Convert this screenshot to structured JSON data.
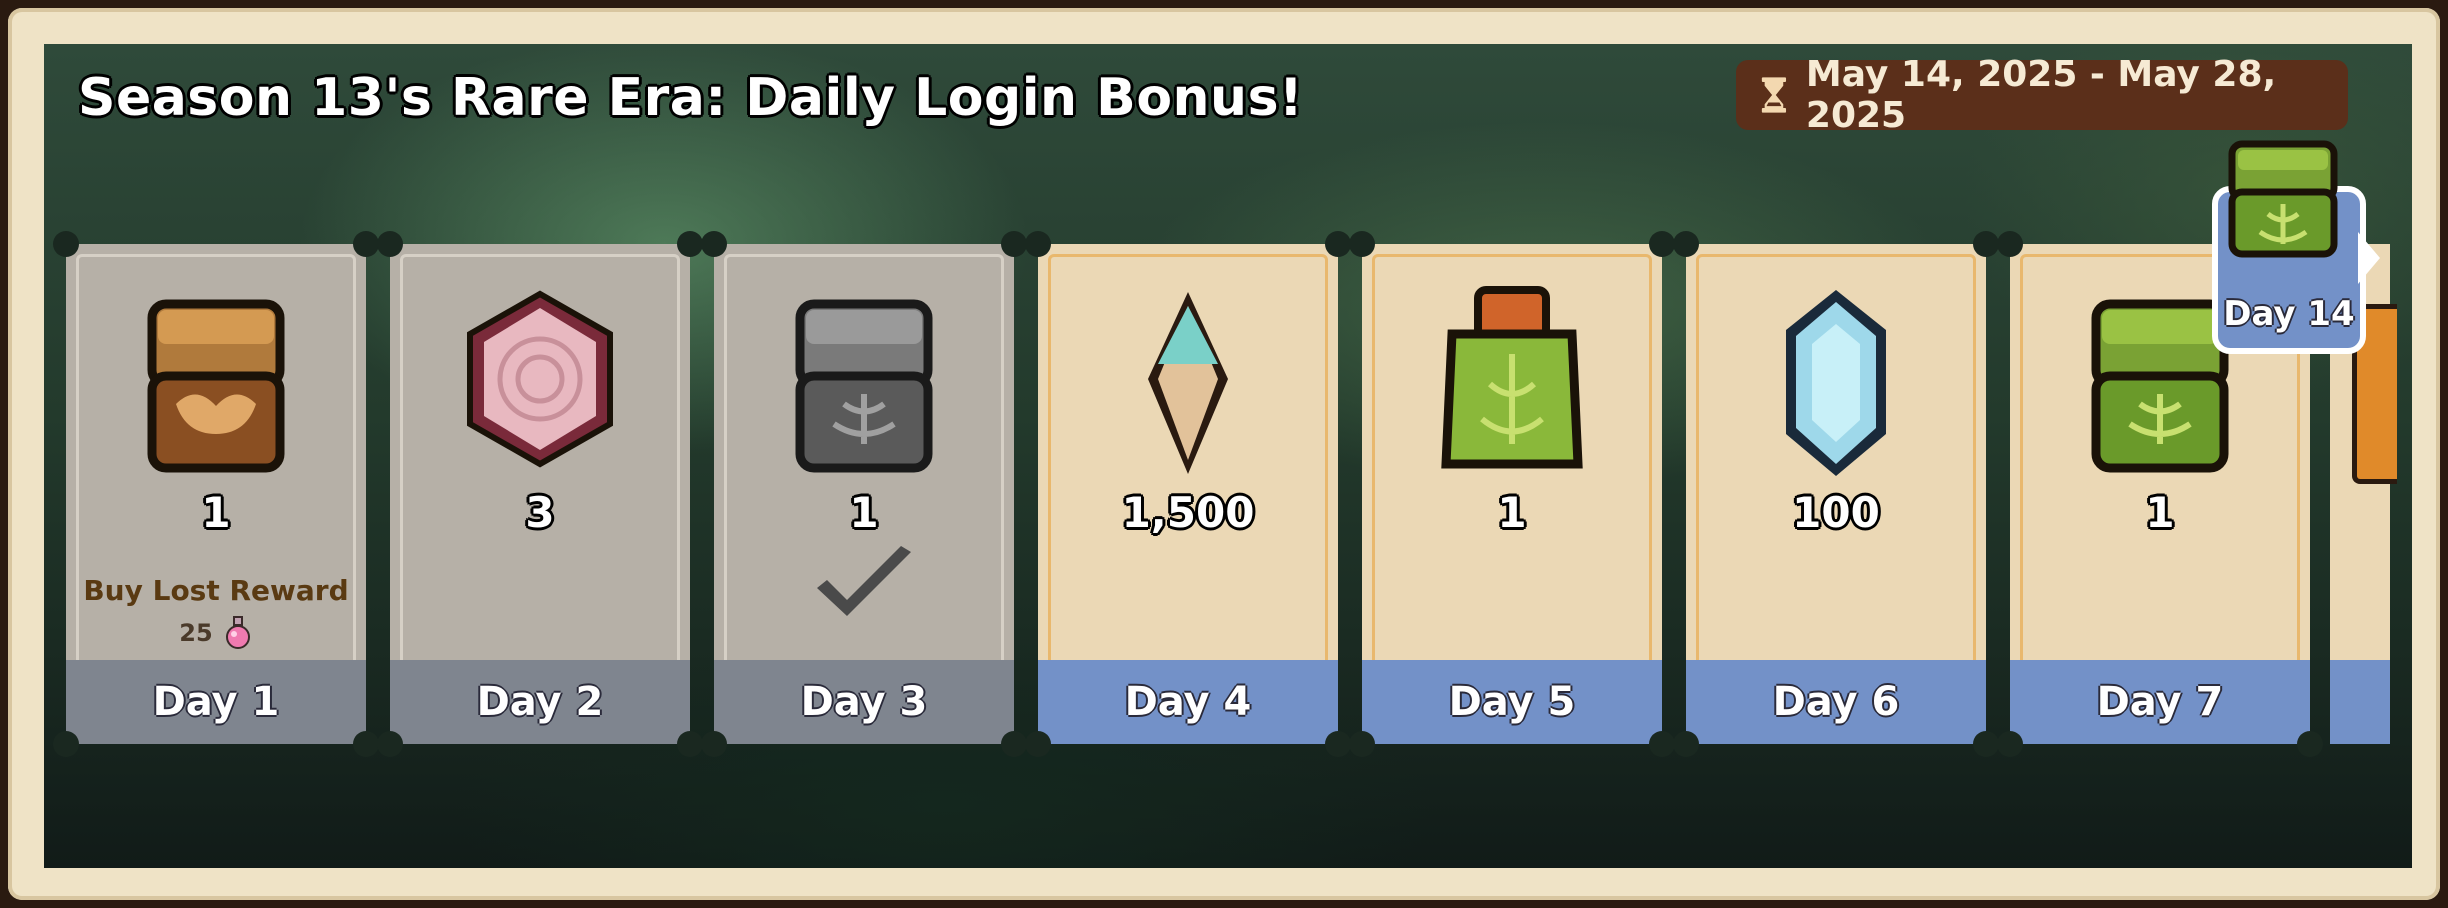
{
  "title": "Season 13's Rare Era: Daily Login Bonus!",
  "date_range": "May 14, 2025 - May 28, 2025",
  "icons": {
    "timer": "hourglass-icon",
    "lost_reward_currency": "pink-potion-icon",
    "claimed": "checkmark-icon"
  },
  "colors": {
    "past_daybar": "#7f858f",
    "future_daybar": "#7391c8",
    "date_pill": "#5b2f1a"
  },
  "days": [
    {
      "label": "Day 1",
      "quantity": "1",
      "reward_icon": "wooden-chest-icon",
      "state": "missed",
      "buy_lost_label": "Buy Lost Reward",
      "buy_lost_cost": "25"
    },
    {
      "label": "Day 2",
      "quantity": "3",
      "reward_icon": "pink-hexagon-gem-icon",
      "state": "missed"
    },
    {
      "label": "Day 3",
      "quantity": "1",
      "reward_icon": "stone-chest-icon",
      "state": "claimed"
    },
    {
      "label": "Day 4",
      "quantity": "1,500",
      "reward_icon": "crystal-shard-icon",
      "state": "upcoming"
    },
    {
      "label": "Day 5",
      "quantity": "1",
      "reward_icon": "green-pouch-icon",
      "state": "upcoming"
    },
    {
      "label": "Day 6",
      "quantity": "100",
      "reward_icon": "blue-gem-icon",
      "state": "upcoming"
    },
    {
      "label": "Day 7",
      "quantity": "1",
      "reward_icon": "green-chest-icon",
      "state": "upcoming"
    }
  ],
  "final_reward": {
    "label": "Day 14",
    "reward_icon": "green-chest-icon"
  }
}
